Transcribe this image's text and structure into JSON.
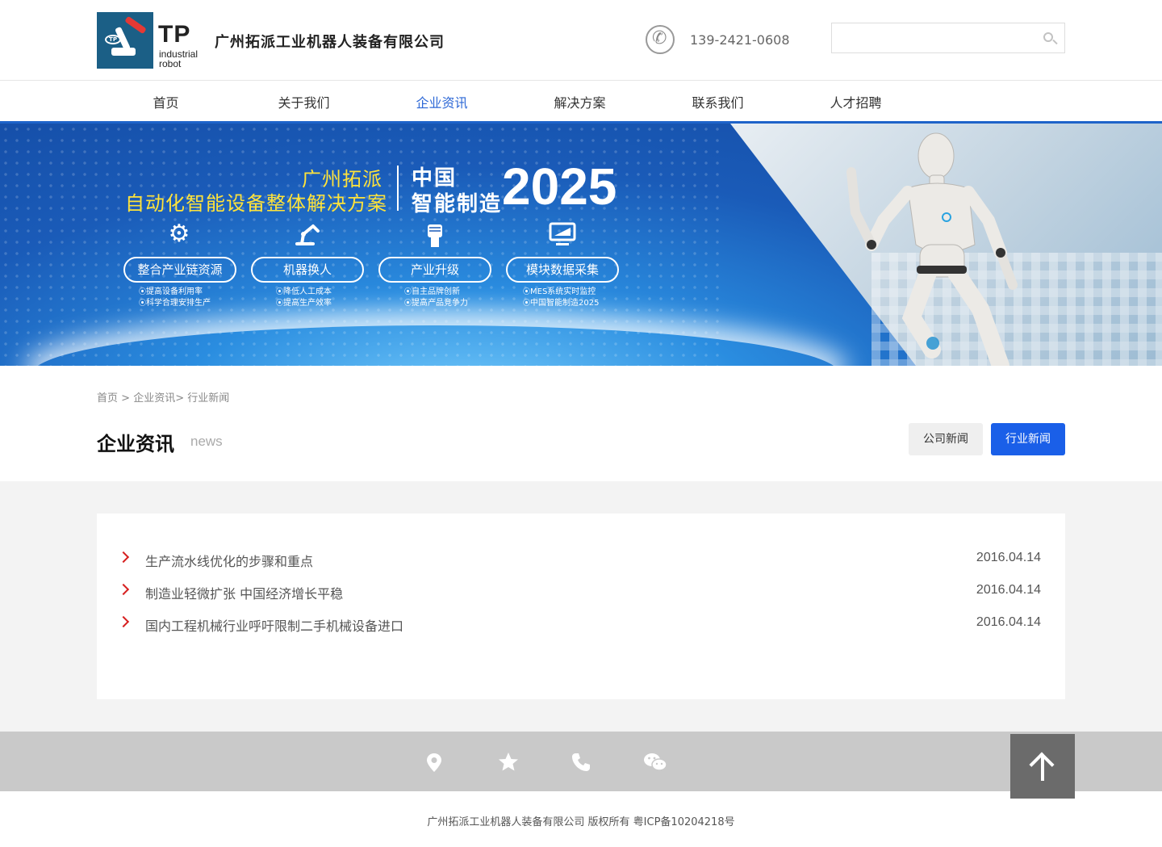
{
  "header": {
    "logo_big": "TP",
    "logo_small": "industrial robot",
    "company_name": "广州拓派工业机器人装备有限公司",
    "phone": "139-2421-0608",
    "search_placeholder": ""
  },
  "nav": [
    "首页",
    "关于我们",
    "企业资讯",
    "解决方案",
    "联系我们",
    "人才招聘"
  ],
  "nav_active": "企业资讯",
  "banner": {
    "title_line1": "广州拓派",
    "title_line2": "自动化智能设备整体解决方案",
    "cn_line1": "中国",
    "cn_line2": "智能制造",
    "year": "2025",
    "features": [
      {
        "icon": "gears-icon",
        "label": "整合产业链资源",
        "subs": [
          "提高设备利用率",
          "科学合理安排生产"
        ]
      },
      {
        "icon": "robot-arm-icon",
        "label": "机器换人",
        "subs": [
          "降低人工成本",
          "提高生产效率"
        ]
      },
      {
        "icon": "fist-icon",
        "label": "产业升级",
        "subs": [
          "自主品牌创新",
          "提高产品竞争力"
        ]
      },
      {
        "icon": "monitor-icon",
        "label": "模块数据采集",
        "subs": [
          "MES系统实时监控",
          "中国智能制造2025"
        ]
      }
    ]
  },
  "breadcrumb": [
    "首页",
    " > ",
    "企业资讯",
    "> ",
    "行业新闻"
  ],
  "section": {
    "title": "企业资讯",
    "subtitle": "news",
    "tab_company": "公司新闻",
    "tab_industry": "行业新闻"
  },
  "news": [
    {
      "title": "生产流水线优化的步骤和重点",
      "date": "2016.04.14"
    },
    {
      "title": "制造业轻微扩张 中国经济增长平稳",
      "date": "2016.04.14"
    },
    {
      "title": "国内工程机械行业呼吁限制二手机械设备进口",
      "date": "2016.04.14"
    }
  ],
  "footer": {
    "icons": [
      "location-icon",
      "star-icon",
      "phone-icon",
      "wechat-icon"
    ],
    "copyright": "广州拓派工业机器人装备有限公司 版权所有 粤ICP备10204218号"
  },
  "colors": {
    "accent": "#1e63c9",
    "tab_active": "#1a5fe8",
    "bullet": "#d61f1f",
    "banner_title": "#ffe33a"
  }
}
